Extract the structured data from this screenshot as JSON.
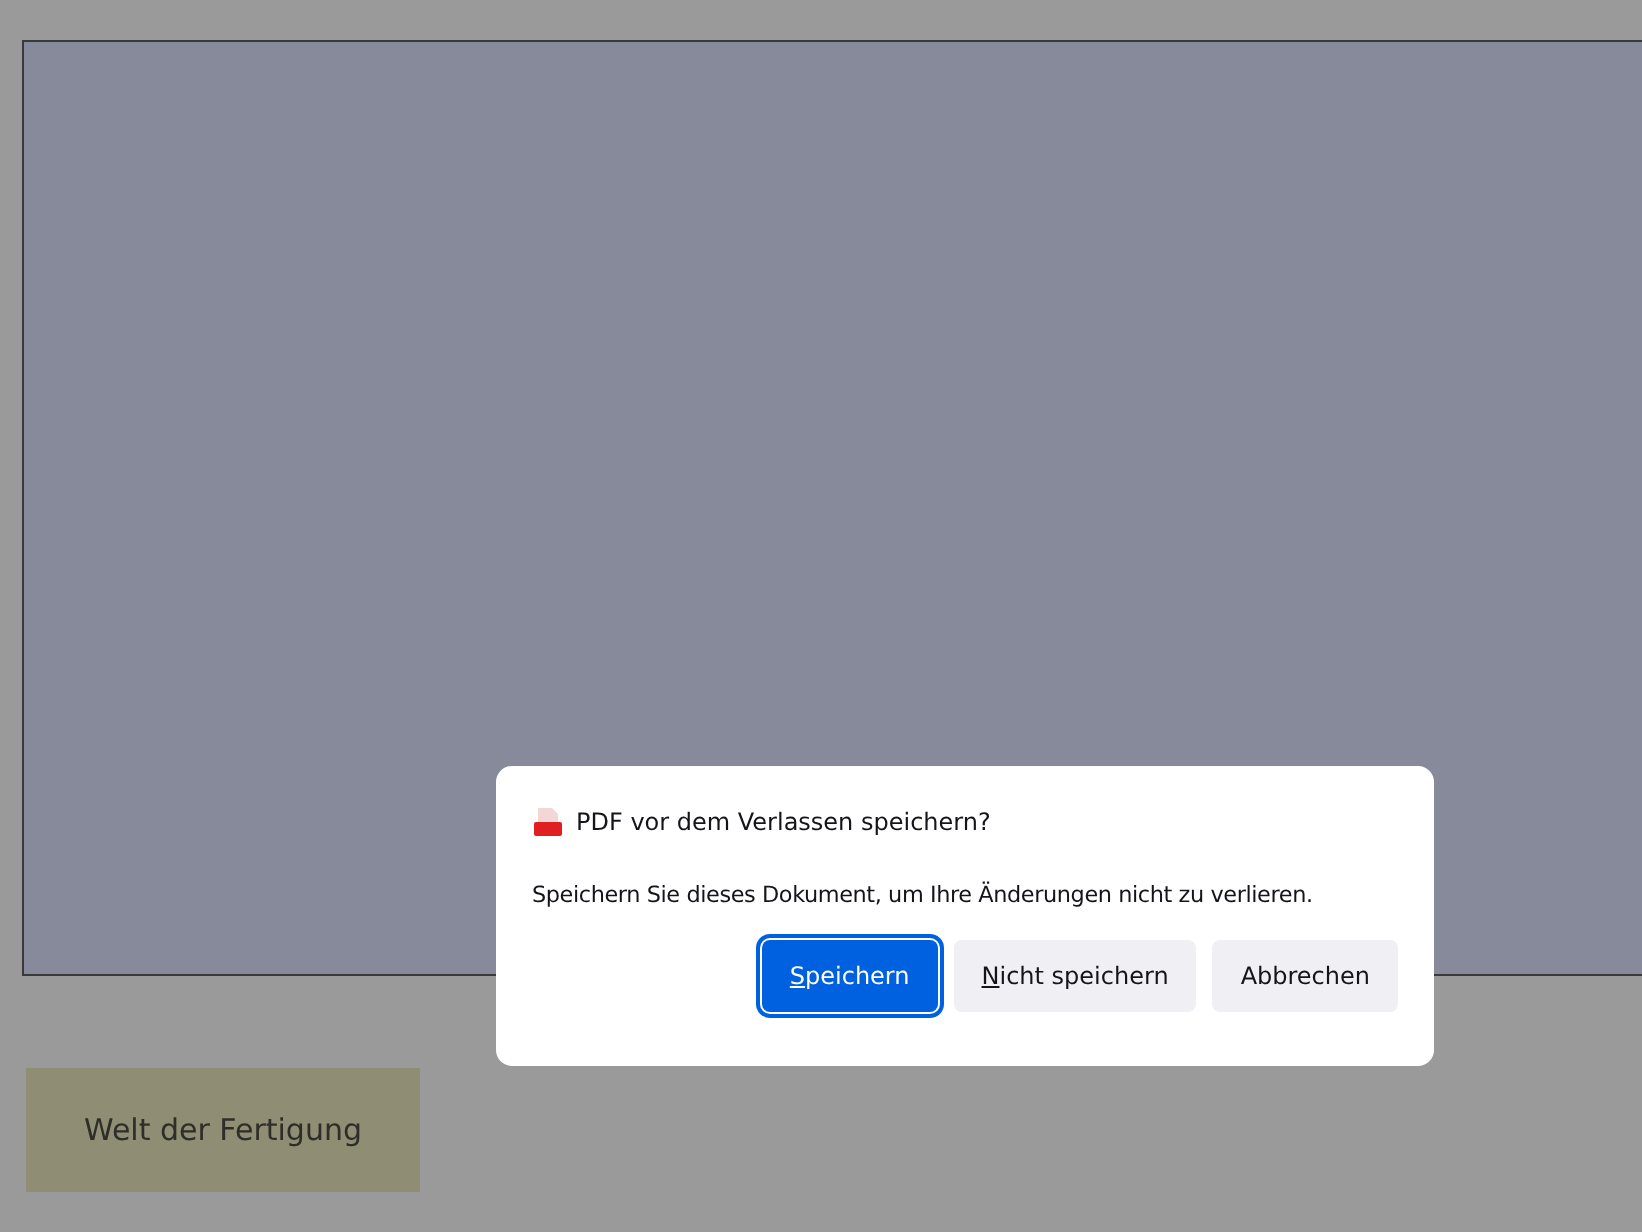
{
  "page_button": {
    "label": "Welt der Fertigung"
  },
  "dialog": {
    "title": "PDF vor dem Verlassen speichern?",
    "message": "Speichern Sie dieses Dokument, um Ihre Änderungen nicht zu verlieren.",
    "buttons": [
      {
        "mnemonic": "S",
        "label_rest": "peichern",
        "kind": "primary"
      },
      {
        "mnemonic": "N",
        "label_rest": "icht speichern",
        "kind": "secondary"
      },
      {
        "label": "Abbrechen",
        "kind": "secondary"
      }
    ]
  }
}
